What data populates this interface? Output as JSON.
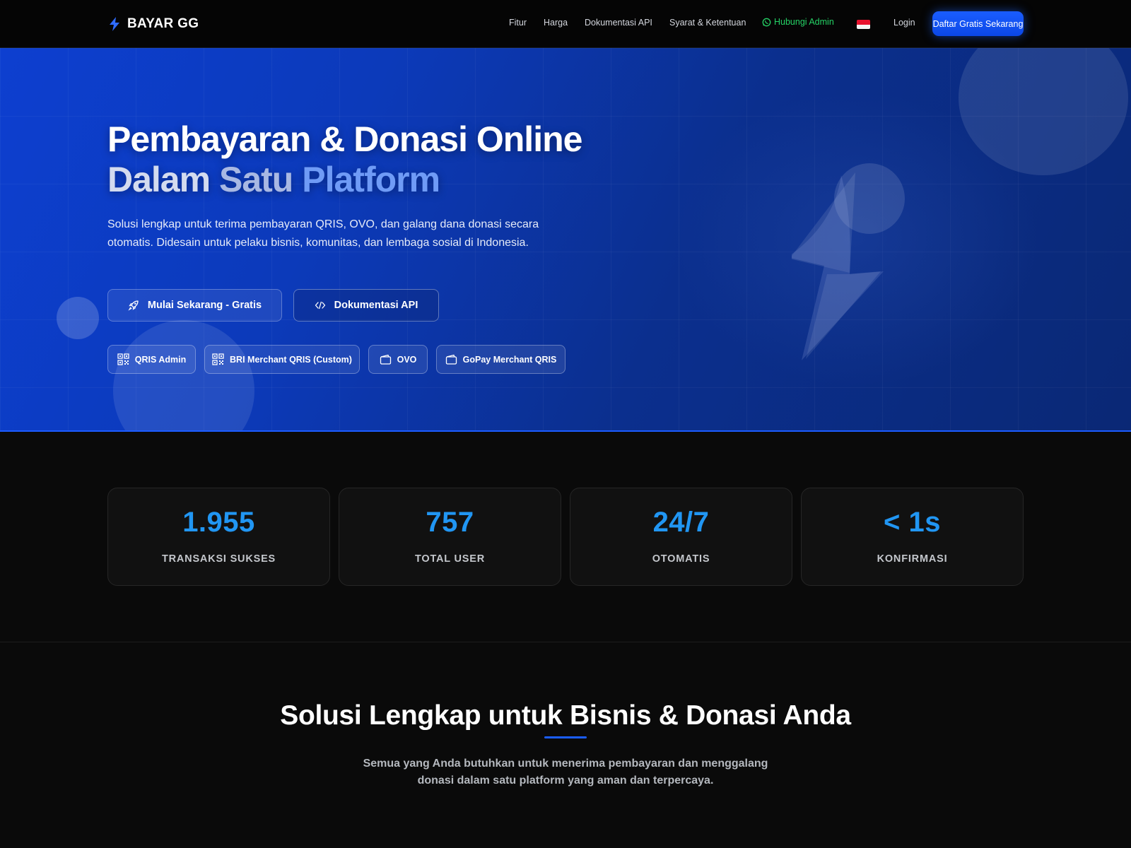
{
  "nav": {
    "brand": "BAYAR GG",
    "links": [
      "Fitur",
      "Harga",
      "Dokumentasi API",
      "Syarat & Ketentuan"
    ],
    "admin_label": "Hubungi Admin",
    "login_label": "Login",
    "cta_label": "Daftar Gratis Sekarang",
    "flag_icon": "indonesia-flag-icon"
  },
  "hero": {
    "title_line1": "Pembayaran & Donasi Online",
    "title_line2_a": "Dalam",
    "title_line2_b": "Satu",
    "title_line2_c": "Platform",
    "description": "Solusi lengkap untuk terima pembayaran QRIS, OVO, dan galang dana donasi secara otomatis. Didesain untuk pelaku bisnis, komunitas, dan lembaga sosial di Indonesia.",
    "btn_start": "Mulai Sekarang - Gratis",
    "btn_api": "Dokumentasi API",
    "methods": [
      {
        "label": "QRIS Admin",
        "icon": "qr-icon"
      },
      {
        "label": "BRI Merchant QRIS (Custom)",
        "icon": "qr-icon"
      },
      {
        "label": "OVO",
        "icon": "wallet-icon"
      },
      {
        "label": "GoPay Merchant QRIS",
        "icon": "wallet-icon"
      }
    ]
  },
  "stats": [
    {
      "value": "1.955",
      "label": "TRANSAKSI SUKSES"
    },
    {
      "value": "757",
      "label": "TOTAL USER"
    },
    {
      "value": "24/7",
      "label": "OTOMATIS"
    },
    {
      "value": "< 1s",
      "label": "KONFIRMASI"
    }
  ],
  "features": {
    "title": "Solusi Lengkap untuk Bisnis & Donasi Anda",
    "subtitle": "Semua yang Anda butuhkan untuk menerima pembayaran dan menggalang donasi dalam satu platform yang aman dan terpercaya."
  },
  "colors": {
    "accent": "#1a5dff",
    "stat_value": "#2196f3",
    "whatsapp": "#25d366",
    "hero_blue": "#0d3fd0"
  }
}
